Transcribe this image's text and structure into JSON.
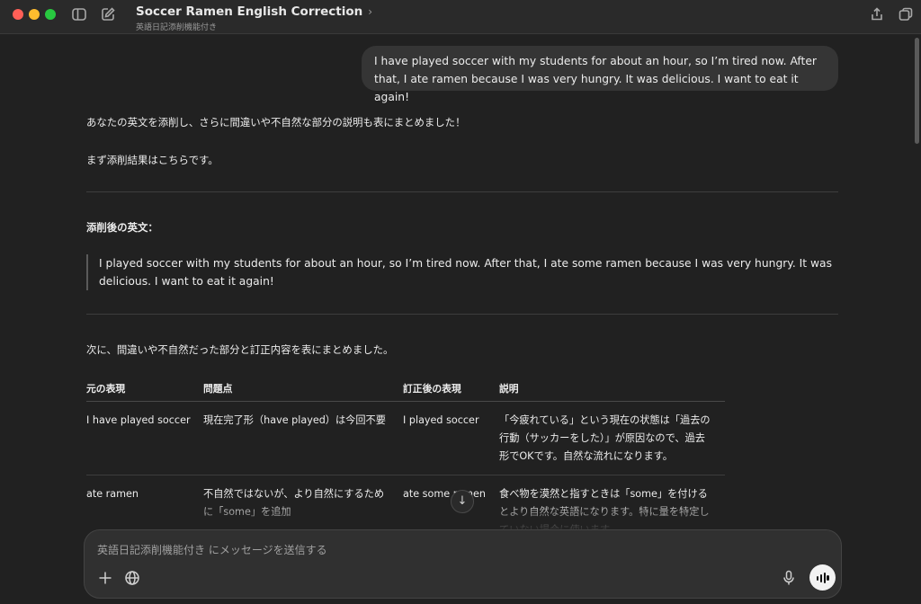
{
  "window": {
    "title": "Soccer Ramen English Correction",
    "subtitle": "英語日記添削機能付き",
    "title_chevron": "›"
  },
  "icons": {
    "sidebar_toggle": "sidebar-toggle-icon",
    "new_chat": "new-chat-icon",
    "share": "share-icon",
    "new_window": "new-window-icon",
    "plus": "plus-icon",
    "globe": "globe-icon",
    "mic": "microphone-icon",
    "voice": "voice-mode-icon",
    "scroll_down": "arrow-down-icon"
  },
  "user_message": "I have played soccer with my students for about an hour, so I’m tired now. After that, I ate ramen because I was very hungry. It was delicious. I want to eat it again!",
  "assistant": {
    "intro": "あなたの英文を添削し、さらに間違いや不自然な部分の説明も表にまとめました！",
    "lead": "まず添削結果はこちらです。",
    "corrected_heading": "添削後の英文：",
    "corrected_text": "I played soccer with my students for about an hour, so I’m tired now. After that, I ate some ramen because I was very hungry. It was delicious. I want to eat it again!",
    "table_intro": "次に、間違いや不自然だった部分と訂正内容を表にまとめました。",
    "table": {
      "headers": [
        "元の表現",
        "問題点",
        "訂正後の表現",
        "説明"
      ],
      "rows": [
        [
          "I have played soccer",
          "現在完了形（have played）は今回不要",
          "I played soccer",
          "「今疲れている」という現在の状態は「過去の行動（サッカーをした）」が原因なので、過去形でOKです。自然な流れになります。"
        ],
        [
          "ate ramen",
          "不自然ではないが、より自然にするために「some」を追加",
          "ate some ramen",
          "食べ物を漠然と指すときは「some」を付けるとより自然な英語になります。特に量を特定していない場合に使います。"
        ]
      ]
    }
  },
  "composer": {
    "placeholder": "英語日記添削機能付き にメッセージを送信する",
    "value": ""
  },
  "scroll_down_glyph": "↓",
  "colors": {
    "background": "#212121",
    "bubble": "#353535",
    "composer": "#303030",
    "text": "#ececec",
    "traffic_red": "#ff5f57",
    "traffic_yellow": "#febc2e",
    "traffic_green": "#28c840"
  }
}
